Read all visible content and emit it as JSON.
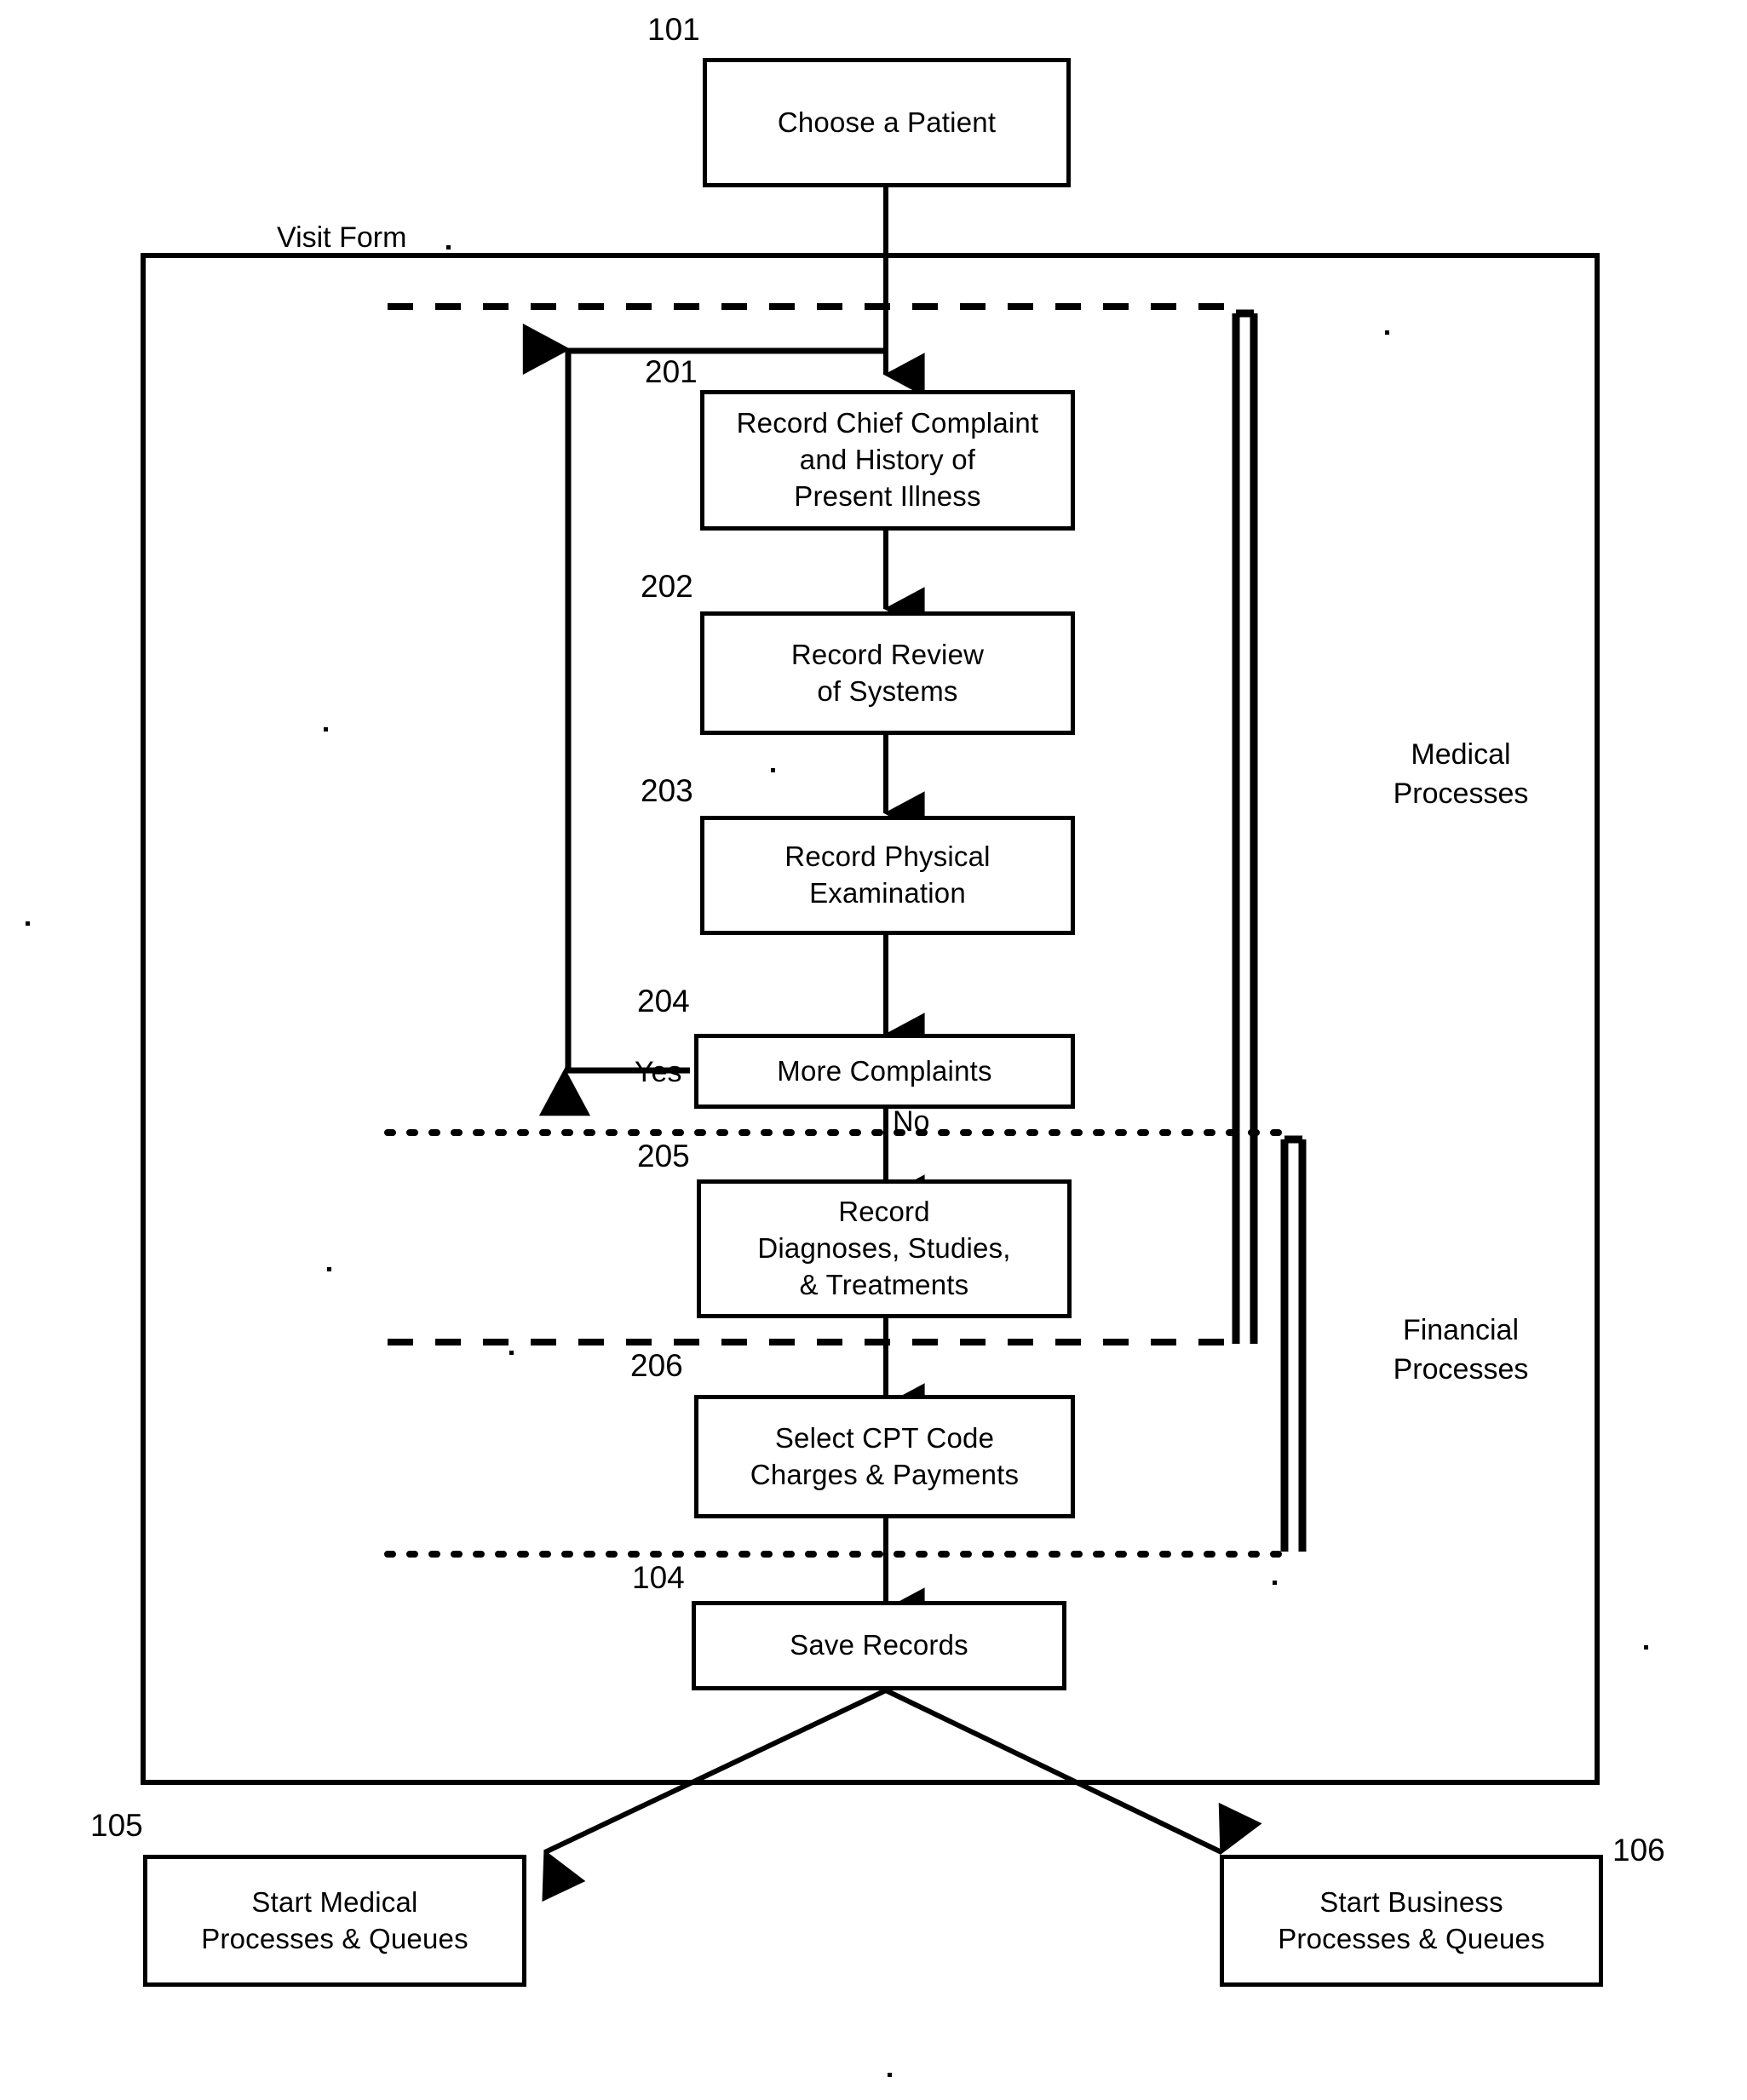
{
  "diagram": {
    "title_labels": {
      "visit_form": "Visit Form",
      "medical_processes": "Medical\nProcesses",
      "financial_processes": "Financial\nProcesses"
    },
    "nodes": [
      {
        "id": "n101",
        "ref": "101",
        "label": "Choose a Patient"
      },
      {
        "id": "n201",
        "ref": "201",
        "label": "Record Chief Complaint\nand History of\nPresent Illness"
      },
      {
        "id": "n202",
        "ref": "202",
        "label": "Record Review\nof Systems"
      },
      {
        "id": "n203",
        "ref": "203",
        "label": "Record Physical\nExamination"
      },
      {
        "id": "n204",
        "ref": "204",
        "label": "More Complaints"
      },
      {
        "id": "n205",
        "ref": "205",
        "label": "Record\nDiagnoses, Studies,\n& Treatments"
      },
      {
        "id": "n206",
        "ref": "206",
        "label": "Select CPT Code\nCharges & Payments"
      },
      {
        "id": "n104",
        "ref": "104",
        "label": "Save Records"
      },
      {
        "id": "n105",
        "ref": "105",
        "label": "Start Medical\nProcesses & Queues"
      },
      {
        "id": "n106",
        "ref": "106",
        "label": "Start Business\nProcesses & Queues"
      }
    ],
    "edge_labels": {
      "yes": "Yes",
      "no": "No"
    },
    "colors": {
      "stroke": "#000000",
      "background": "#ffffff"
    }
  }
}
